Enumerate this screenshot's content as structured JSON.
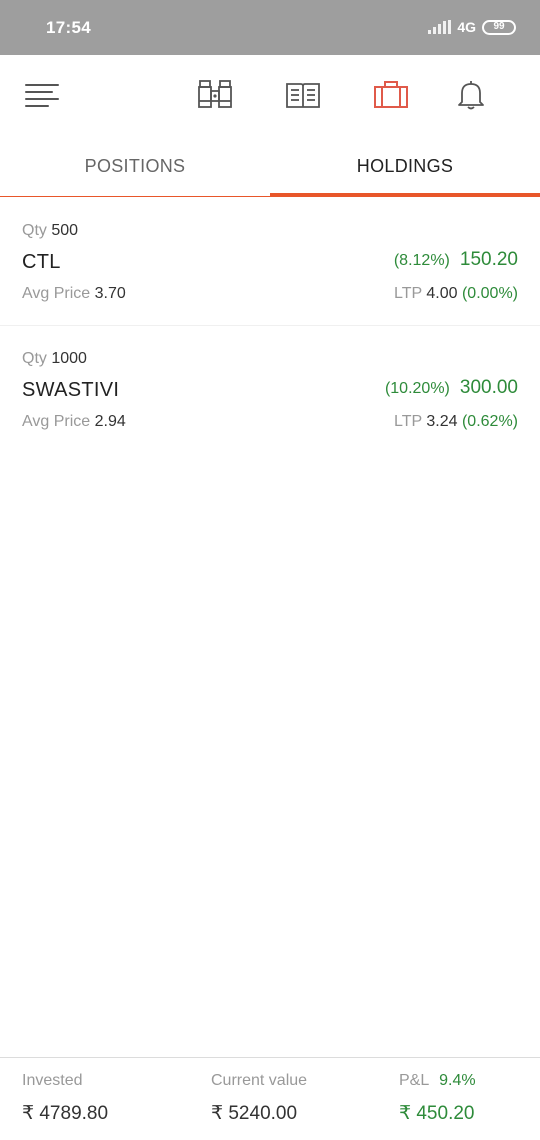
{
  "status_bar": {
    "time": "17:54",
    "network": "4G",
    "battery": "99"
  },
  "toolbar": {
    "icons": [
      "menu-icon",
      "binoculars-icon",
      "book-icon",
      "briefcase-icon",
      "bell-icon"
    ],
    "active_color": "#e05a4a"
  },
  "tabs": {
    "positions": "POSITIONS",
    "holdings": "HOLDINGS",
    "active": "HOLDINGS"
  },
  "labels": {
    "qty": "Qty",
    "avg_price": "Avg Price",
    "ltp": "LTP"
  },
  "holdings": [
    {
      "qty": "500",
      "symbol": "CTL",
      "avg_price": "3.70",
      "pnl_pct": "(8.12%)",
      "pnl": "150.20",
      "ltp": "4.00",
      "ltp_change": "(0.00%)"
    },
    {
      "qty": "1000",
      "symbol": "SWASTIVI",
      "avg_price": "2.94",
      "pnl_pct": "(10.20%)",
      "pnl": "300.00",
      "ltp": "3.24",
      "ltp_change": "(0.62%)"
    }
  ],
  "summary": {
    "invested_label": "Invested",
    "invested": "₹ 4789.80",
    "current_label": "Current value",
    "current": "₹ 5240.00",
    "pl_label": "P&L",
    "pl_pct": "9.4%",
    "pl": "₹ 450.20"
  },
  "colors": {
    "accent": "#e8562a",
    "positive": "#2e8b3a",
    "status_bar": "#9e9e9e"
  }
}
